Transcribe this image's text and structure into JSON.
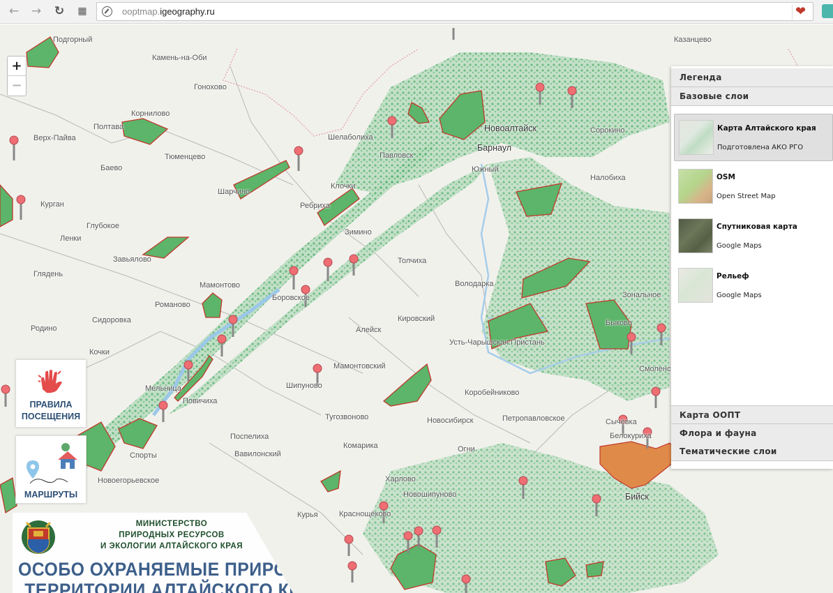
{
  "browser": {
    "url_prefix": "ooptmap.",
    "url_domain": "igeography.ru"
  },
  "zoom": {
    "in_label": "+",
    "out_label": "−"
  },
  "panel": {
    "legend_label": "Легенда",
    "base_layers_label": "Базовые слои",
    "layers": [
      {
        "name": "Карта Алтайского края",
        "sub": "Подготовлена АКО РГО",
        "selected": true
      },
      {
        "name": "OSM",
        "sub": "Open Street Map",
        "selected": false
      },
      {
        "name": "Спутниковая карта",
        "sub": "Google Maps",
        "selected": false
      },
      {
        "name": "Рельеф",
        "sub": "Google Maps",
        "selected": false
      }
    ],
    "oopt_label": "Карта ООПТ",
    "flora_label": "Флора и фауна",
    "thematic_label": "Тематические слои"
  },
  "cards": {
    "rules_line1": "ПРАВИЛА",
    "rules_line2": "ПОСЕЩЕНИЯ",
    "routes_label": "МАРШРУТЫ"
  },
  "ministry": {
    "line1": "МИНИСТЕРСТВО",
    "line2": "ПРИРОДНЫХ РЕСУРСОВ",
    "line3": "И ЭКОЛОГИИ АЛТАЙСКОГО КРАЯ",
    "title1": "ОСОБО ОХРАНЯЕМЫЕ ПРИРОДНЫЕ",
    "title2": "ТЕРРИТОРИИ АЛТАЙСКОГО КРАЯ"
  },
  "places": {
    "p1": "Подгорный",
    "p2": "Камень-на-Оби",
    "p3": "Гоноховo",
    "p4": "Корнилово",
    "p5": "Полтава",
    "p6": "Верх-Пайва",
    "p7": "Тюменцево",
    "p8": "Баево",
    "p9": "Курган",
    "p10": "Глубокое",
    "p11": "Ленки",
    "p12": "Завьялово",
    "p13": "Глядень",
    "p14": "Родино",
    "p15": "Кочки",
    "p16": "Сидоровка",
    "p17": "Романово",
    "p18": "Мамонтово",
    "p19": "Боровское",
    "p20": "Шипуново",
    "p21": "Алейск",
    "p22": "Мамонтовский",
    "p23": "Кировский",
    "p24": "Усть-Чарышская Пристань",
    "p25": "Новоалтайск",
    "p26": "Барнаул",
    "p27": "Южный",
    "p28": "Павловск",
    "p29": "Клочки",
    "p30": "Ребриха",
    "p31": "Зимино",
    "p32": "Толчиха",
    "p33": "Володарка",
    "p34": "Шелаболиха",
    "p35": "Сорокино",
    "p36": "Налобиха",
    "p37": "Петропавловское",
    "p38": "Тугозвоново",
    "p39": "Поспелиха",
    "p40": "Вавилонский",
    "p41": "Комарика",
    "p42": "Огни",
    "p43": "Новосибирск",
    "p44": "Харлово",
    "p45": "Новошипуново",
    "p46": "Курья",
    "p47": "Краснощёково",
    "p48": "Коробейниково",
    "p49": "Сычёвка",
    "p50": "Белокуриха",
    "p51": "Мельница",
    "p52": "Повичиха",
    "p53": "Спорты",
    "p54": "Новоегорьевское",
    "p55": "Смоленское",
    "p56": "Бийск",
    "p57": "Зональное",
    "p58": "Быково",
    "p59": "Казанцево",
    "p60": "Шарчино"
  }
}
